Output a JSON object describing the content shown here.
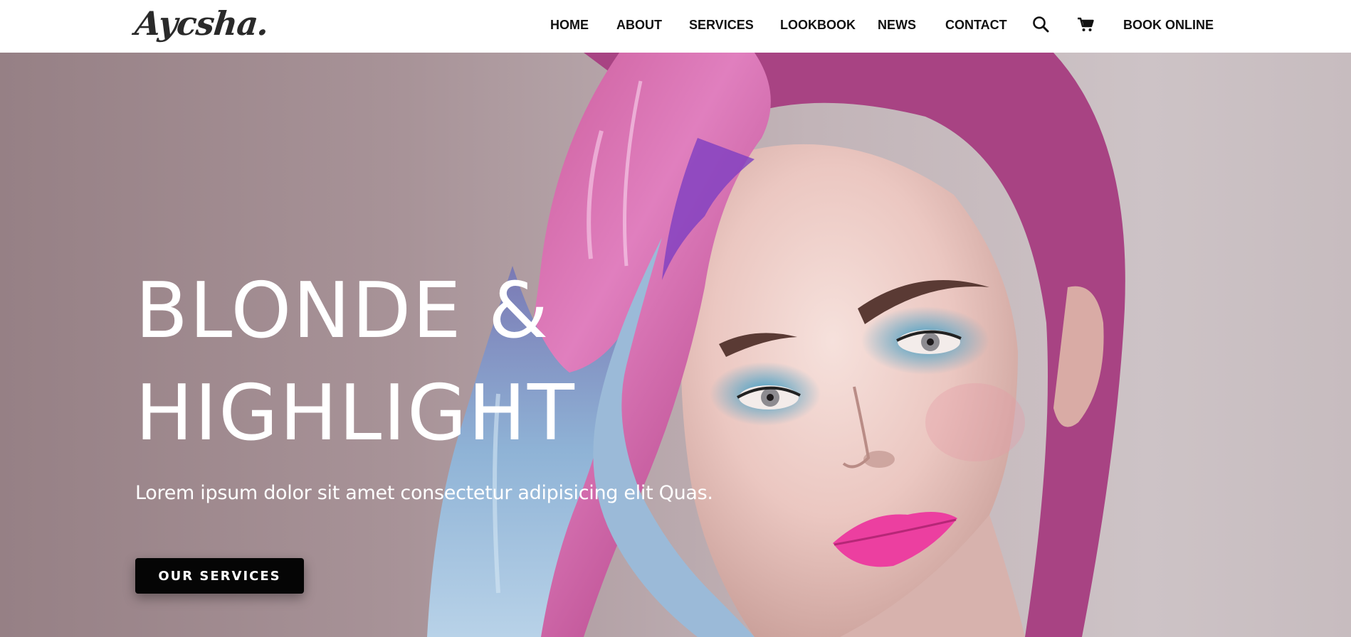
{
  "brand": {
    "logo_text": "Aycsha."
  },
  "nav": {
    "items": [
      "HOME",
      "ABOUT",
      "SERVICES",
      "LOOKBOOK",
      "NEWS",
      "CONTACT"
    ],
    "search_icon": "search-icon",
    "cart_icon": "cart-icon",
    "book_label": "BOOK ONLINE"
  },
  "hero": {
    "title_line1": "BLONDE &",
    "title_line2": "HIGHLIGHT",
    "subtitle": "Lorem ipsum dolor sit amet consectetur adipisicing elit Quas.",
    "cta_label": "OUR SERVICES",
    "image": "portrait-photo"
  },
  "colors": {
    "nav_background": "#ffffff",
    "nav_text": "#111111",
    "hero_text": "#ffffff",
    "cta_background": "#050505",
    "hair_pink": "#d45aa8",
    "hair_blue": "#8fb3d6",
    "lips": "#ec3fa0"
  }
}
